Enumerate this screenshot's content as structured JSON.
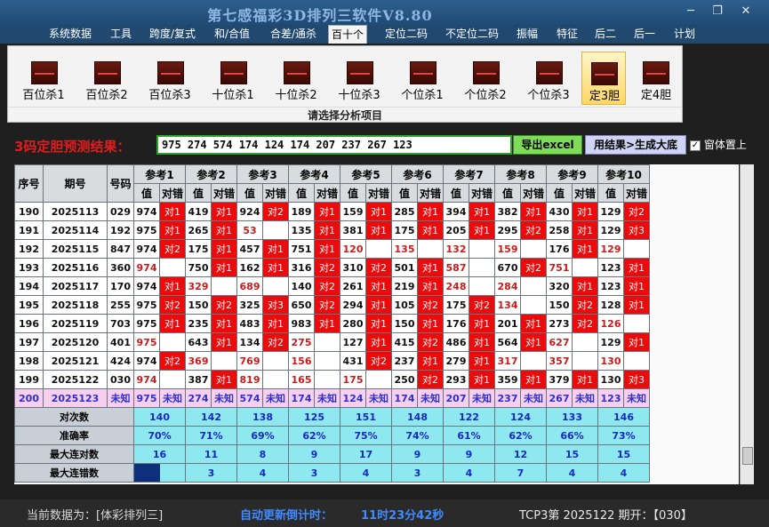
{
  "window": {
    "title": "第七感福彩3D排列三软件V8.80",
    "min": "─",
    "restore": "❐",
    "close": "✕"
  },
  "menu": [
    "系统数据",
    "工具",
    "跨度/复式",
    "和/合值",
    "合差/通杀",
    "百十个",
    "定位二码",
    "不定位二码",
    "振幅",
    "特征",
    "后二",
    "后一",
    "计划"
  ],
  "ribbon": {
    "buttons": [
      "百位杀1",
      "百位杀2",
      "百位杀3",
      "十位杀1",
      "十位杀2",
      "十位杀3",
      "个位杀1",
      "个位杀2",
      "个位杀3",
      "定3胆",
      "定4胆"
    ],
    "selected": 9,
    "group_label": "请选择分析项目"
  },
  "prediction": {
    "label": "3码定胆预测结果：",
    "value": "975 274 574 174 124 174 207 237 267 123",
    "export_button": "导出excel",
    "generate_button": "用结果>生成大底",
    "topmost_label": "窗体置上",
    "topmost_checked": true
  },
  "table": {
    "headers": {
      "seq": "序号",
      "period": "期号",
      "number": "号码",
      "ref_prefix": "参考",
      "value": "值",
      "judge": "对错"
    },
    "rows": [
      {
        "seq": "190",
        "period": "2025113",
        "number": "029",
        "cells": [
          [
            "974",
            "对1"
          ],
          [
            "419",
            "对1"
          ],
          [
            "924",
            "对2"
          ],
          [
            "189",
            "对1"
          ],
          [
            "159",
            "对1"
          ],
          [
            "285",
            "对1"
          ],
          [
            "394",
            "对1"
          ],
          [
            "382",
            "对1"
          ],
          [
            "430",
            "对1"
          ],
          [
            "129",
            "对2"
          ]
        ]
      },
      {
        "seq": "191",
        "period": "2025114",
        "number": "192",
        "cells": [
          [
            "975",
            "对1"
          ],
          [
            "265",
            "对1"
          ],
          [
            "53",
            ""
          ],
          [
            "135",
            "对1"
          ],
          [
            "381",
            "对1"
          ],
          [
            "175",
            "对1"
          ],
          [
            "205",
            "对1"
          ],
          [
            "295",
            "对2"
          ],
          [
            "258",
            "对1"
          ],
          [
            "129",
            "对3"
          ]
        ]
      },
      {
        "seq": "192",
        "period": "2025115",
        "number": "847",
        "cells": [
          [
            "974",
            "对2"
          ],
          [
            "175",
            "对1"
          ],
          [
            "457",
            "对1"
          ],
          [
            "751",
            "对1"
          ],
          [
            "120",
            ""
          ],
          [
            "135",
            ""
          ],
          [
            "132",
            ""
          ],
          [
            "159",
            ""
          ],
          [
            "176",
            "对1"
          ],
          [
            "129",
            ""
          ]
        ]
      },
      {
        "seq": "193",
        "period": "2025116",
        "number": "360",
        "cells": [
          [
            "974",
            ""
          ],
          [
            "750",
            "对1"
          ],
          [
            "162",
            "对1"
          ],
          [
            "316",
            "对2"
          ],
          [
            "310",
            "对2"
          ],
          [
            "501",
            "对1"
          ],
          [
            "587",
            ""
          ],
          [
            "670",
            "对2"
          ],
          [
            "751",
            ""
          ],
          [
            "123",
            "对1"
          ]
        ]
      },
      {
        "seq": "194",
        "period": "2025117",
        "number": "170",
        "cells": [
          [
            "974",
            "对1"
          ],
          [
            "329",
            ""
          ],
          [
            "689",
            ""
          ],
          [
            "140",
            "对2"
          ],
          [
            "261",
            "对1"
          ],
          [
            "219",
            "对1"
          ],
          [
            "248",
            ""
          ],
          [
            "284",
            ""
          ],
          [
            "320",
            "对1"
          ],
          [
            "123",
            "对1"
          ]
        ]
      },
      {
        "seq": "195",
        "period": "2025118",
        "number": "255",
        "cells": [
          [
            "975",
            "对2"
          ],
          [
            "150",
            "对2"
          ],
          [
            "325",
            "对3"
          ],
          [
            "650",
            "对2"
          ],
          [
            "294",
            "对1"
          ],
          [
            "105",
            "对2"
          ],
          [
            "175",
            "对2"
          ],
          [
            "134",
            ""
          ],
          [
            "150",
            "对2"
          ],
          [
            "128",
            "对1"
          ]
        ]
      },
      {
        "seq": "196",
        "period": "2025119",
        "number": "703",
        "cells": [
          [
            "975",
            "对1"
          ],
          [
            "235",
            "对1"
          ],
          [
            "483",
            "对1"
          ],
          [
            "983",
            "对1"
          ],
          [
            "280",
            "对1"
          ],
          [
            "150",
            "对1"
          ],
          [
            "176",
            "对1"
          ],
          [
            "201",
            "对1"
          ],
          [
            "273",
            "对2"
          ],
          [
            "126",
            ""
          ]
        ]
      },
      {
        "seq": "197",
        "period": "2025120",
        "number": "401",
        "cells": [
          [
            "975",
            ""
          ],
          [
            "643",
            "对1"
          ],
          [
            "134",
            "对2"
          ],
          [
            "275",
            ""
          ],
          [
            "127",
            "对1"
          ],
          [
            "415",
            "对2"
          ],
          [
            "486",
            "对1"
          ],
          [
            "564",
            "对1"
          ],
          [
            "627",
            ""
          ],
          [
            "129",
            "对1"
          ]
        ]
      },
      {
        "seq": "198",
        "period": "2025121",
        "number": "424",
        "cells": [
          [
            "974",
            "对2"
          ],
          [
            "369",
            ""
          ],
          [
            "769",
            ""
          ],
          [
            "156",
            ""
          ],
          [
            "431",
            "对2"
          ],
          [
            "237",
            "对1"
          ],
          [
            "279",
            "对1"
          ],
          [
            "317",
            ""
          ],
          [
            "357",
            ""
          ],
          [
            "130",
            ""
          ]
        ]
      },
      {
        "seq": "199",
        "period": "2025122",
        "number": "030",
        "cells": [
          [
            "974",
            ""
          ],
          [
            "387",
            "对1"
          ],
          [
            "819",
            ""
          ],
          [
            "165",
            ""
          ],
          [
            "175",
            ""
          ],
          [
            "250",
            "对2"
          ],
          [
            "293",
            "对1"
          ],
          [
            "359",
            "对1"
          ],
          [
            "379",
            "对1"
          ],
          [
            "130",
            "对3"
          ]
        ]
      }
    ],
    "pred_row": {
      "seq": "200",
      "period": "2025123",
      "number": "未知",
      "cells": [
        [
          "975",
          "未知"
        ],
        [
          "274",
          "未知"
        ],
        [
          "574",
          "未知"
        ],
        [
          "174",
          "未知"
        ],
        [
          "124",
          "未知"
        ],
        [
          "174",
          "未知"
        ],
        [
          "207",
          "未知"
        ],
        [
          "237",
          "未知"
        ],
        [
          "267",
          "未知"
        ],
        [
          "123",
          "未知"
        ]
      ]
    },
    "stats": [
      {
        "label": "对次数",
        "values": [
          "140",
          "142",
          "138",
          "125",
          "151",
          "148",
          "122",
          "124",
          "133",
          "146"
        ]
      },
      {
        "label": "准确率",
        "values": [
          "70%",
          "71%",
          "69%",
          "62%",
          "75%",
          "74%",
          "61%",
          "62%",
          "66%",
          "73%"
        ]
      },
      {
        "label": "最大连对数",
        "values": [
          "16",
          "11",
          "8",
          "9",
          "17",
          "9",
          "9",
          "12",
          "15",
          "15"
        ]
      },
      {
        "label": "最大连错数",
        "values": [
          "",
          "3",
          "4",
          "3",
          "4",
          "3",
          "4",
          "7",
          "4",
          "4"
        ]
      }
    ]
  },
  "status": {
    "current_data": "当前数据为：[体彩排列三]",
    "countdown_label": "自动更新倒计时：",
    "countdown_value": "11时23分42秒",
    "last_draw": "TCP3第 2025122 期开：【030】"
  },
  "colors": {
    "hit": "#ea0c0c",
    "pred_row": "#f7cfef",
    "stat_row": "#8ee8ef",
    "accent_green": "#7fdc58"
  }
}
